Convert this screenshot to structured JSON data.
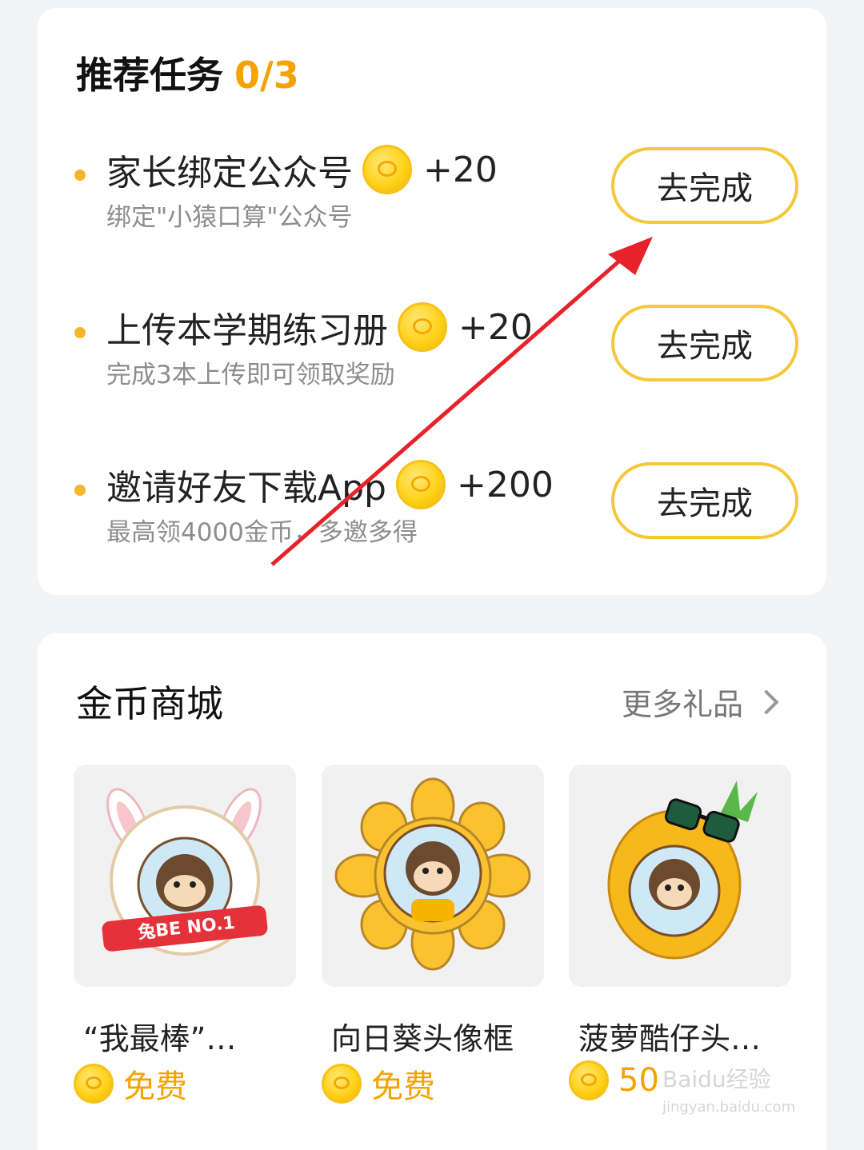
{
  "tasks_section": {
    "title": "推荐任务",
    "progress": "0/3",
    "items": [
      {
        "title": "家长绑定公众号",
        "reward": "+20",
        "desc": "绑定\"小猿口算\"公众号",
        "button": "去完成"
      },
      {
        "title": "上传本学期练习册",
        "reward": "+20",
        "desc": "完成3本上传即可领取奖励",
        "button": "去完成"
      },
      {
        "title": "邀请好友下载App",
        "reward": "+200",
        "desc": "最高领4000金币，多邀多得",
        "button": "去完成"
      }
    ]
  },
  "mall_section": {
    "title": "金币商城",
    "more_link": "更多礼品",
    "products": [
      {
        "name": "“我最棒”…",
        "price": "免费",
        "badge_text": "兔BE NO.1"
      },
      {
        "name": "向日葵头像框",
        "price": "免费"
      },
      {
        "name": "菠萝酷仔头…",
        "price": "50"
      }
    ]
  },
  "colors": {
    "accent": "#f6a200",
    "button_border": "#f5c73a",
    "annotation_arrow": "#e8222b"
  },
  "icons": {
    "coin": "gold-coin-icon",
    "chevron": "chevron-right-icon",
    "bullet": "bullet-dot-icon"
  },
  "watermark": {
    "main": "Baidu经验",
    "sub": "jingyan.baidu.com"
  }
}
